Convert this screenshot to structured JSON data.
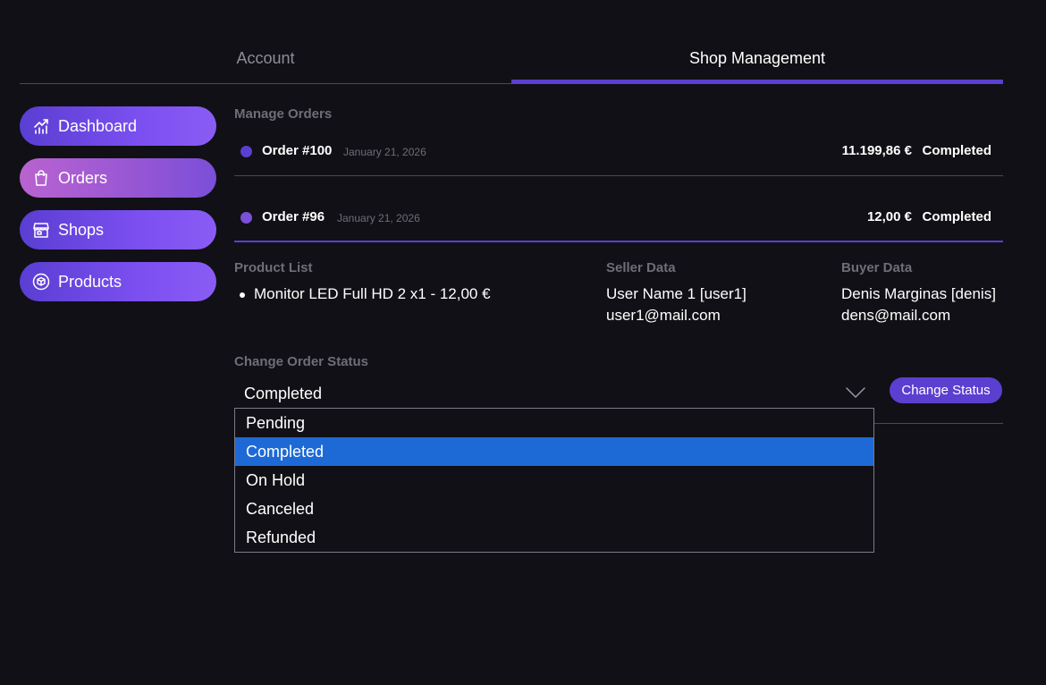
{
  "tabs": [
    {
      "label": "Account",
      "active": false
    },
    {
      "label": "Shop Management",
      "active": true
    }
  ],
  "sidebar": {
    "items": [
      {
        "label": "Dashboard",
        "icon": "chart-icon",
        "active": false
      },
      {
        "label": "Orders",
        "icon": "shopping-bag-icon",
        "active": true
      },
      {
        "label": "Shops",
        "icon": "store-icon",
        "active": false
      },
      {
        "label": "Products",
        "icon": "cube-icon",
        "active": false
      }
    ]
  },
  "main": {
    "section_title": "Manage Orders",
    "orders": [
      {
        "name": "Order #100",
        "date": "January 21, 2026",
        "price": "11.199,86 €",
        "status": "Completed",
        "dot_color": "#5b3fd0"
      },
      {
        "name": "Order #96",
        "date": "January 21, 2026",
        "price": "12,00 €",
        "status": "Completed",
        "dot_color": "#7b4fd8"
      }
    ],
    "details": {
      "product_list_title": "Product List",
      "products": [
        "Monitor LED Full HD 2 x1 - 12,00 €"
      ],
      "seller_title": "Seller Data",
      "seller_name": "User Name 1 [user1]",
      "seller_email": "user1@mail.com",
      "buyer_title": "Buyer Data",
      "buyer_name": "Denis Marginas [denis]",
      "buyer_email": "dens@mail.com"
    },
    "status_section": {
      "title": "Change Order Status",
      "selected": "Completed",
      "button_label": "Change Status",
      "options": [
        "Pending",
        "Completed",
        "On Hold",
        "Canceled",
        "Refunded"
      ]
    }
  },
  "colors": {
    "background": "#111016",
    "accent": "#5b3fd0",
    "selected_option": "#1d6ad6"
  }
}
